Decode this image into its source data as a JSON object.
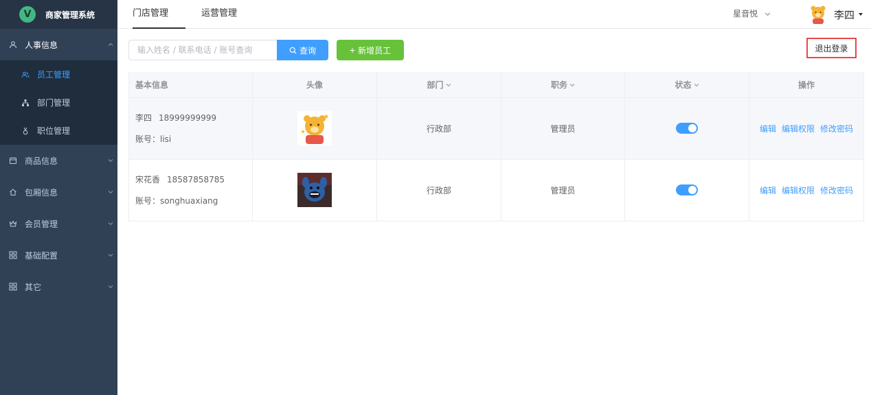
{
  "sidebar": {
    "logo_letter": "V",
    "logo_text": "商家管理系统",
    "groups": [
      {
        "label": "人事信息",
        "icon": "user-icon",
        "open": true,
        "items": [
          {
            "label": "员工管理",
            "icon": "users-icon",
            "active": true
          },
          {
            "label": "部门管理",
            "icon": "org-chart-icon",
            "active": false
          },
          {
            "label": "职位管理",
            "icon": "badge-icon",
            "active": false
          }
        ]
      },
      {
        "label": "商品信息",
        "icon": "goods-icon"
      },
      {
        "label": "包厢信息",
        "icon": "home-icon"
      },
      {
        "label": "会员管理",
        "icon": "crown-icon"
      },
      {
        "label": "基础配置",
        "icon": "grid-icon"
      },
      {
        "label": "其它",
        "icon": "grid-icon"
      }
    ]
  },
  "header": {
    "tabs": [
      "门店管理",
      "运营管理"
    ],
    "shop": "星音悦",
    "user": "李四"
  },
  "toolbar": {
    "search_placeholder": "输入姓名 / 联系电话 / 账号查询",
    "search_label": "查询",
    "add_label": "新增员工",
    "logout_label": "退出登录"
  },
  "table": {
    "columns": [
      "基本信息",
      "头像",
      "部门",
      "职务",
      "状态",
      "操作"
    ],
    "rows": [
      {
        "name": "李四",
        "phone": "18999999999",
        "account": "账号：lisi",
        "department": "行政部",
        "position": "管理员",
        "enabled": true
      },
      {
        "name": "宋花香",
        "phone": "18587858785",
        "account": "账号：songhuaxiang",
        "department": "行政部",
        "position": "管理员",
        "enabled": true
      }
    ],
    "actions": [
      "编辑",
      "编辑权限",
      "修改密码"
    ]
  },
  "colors": {
    "sidebar": "#304156",
    "accent": "#409eff",
    "success": "#67c23a",
    "logout_border": "#e5484d"
  }
}
